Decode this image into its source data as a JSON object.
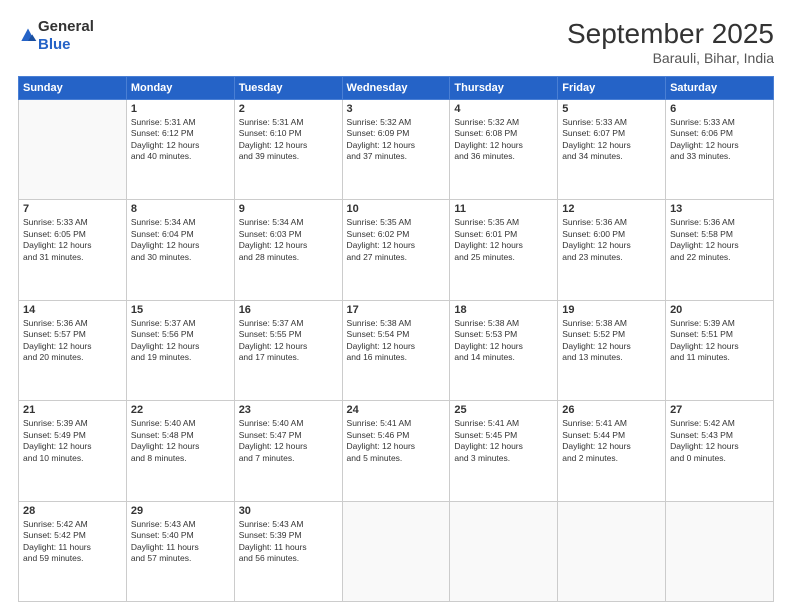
{
  "header": {
    "logo_general": "General",
    "logo_blue": "Blue",
    "month": "September 2025",
    "location": "Barauli, Bihar, India"
  },
  "weekdays": [
    "Sunday",
    "Monday",
    "Tuesday",
    "Wednesday",
    "Thursday",
    "Friday",
    "Saturday"
  ],
  "weeks": [
    [
      {
        "day": "",
        "info": ""
      },
      {
        "day": "1",
        "info": "Sunrise: 5:31 AM\nSunset: 6:12 PM\nDaylight: 12 hours\nand 40 minutes."
      },
      {
        "day": "2",
        "info": "Sunrise: 5:31 AM\nSunset: 6:10 PM\nDaylight: 12 hours\nand 39 minutes."
      },
      {
        "day": "3",
        "info": "Sunrise: 5:32 AM\nSunset: 6:09 PM\nDaylight: 12 hours\nand 37 minutes."
      },
      {
        "day": "4",
        "info": "Sunrise: 5:32 AM\nSunset: 6:08 PM\nDaylight: 12 hours\nand 36 minutes."
      },
      {
        "day": "5",
        "info": "Sunrise: 5:33 AM\nSunset: 6:07 PM\nDaylight: 12 hours\nand 34 minutes."
      },
      {
        "day": "6",
        "info": "Sunrise: 5:33 AM\nSunset: 6:06 PM\nDaylight: 12 hours\nand 33 minutes."
      }
    ],
    [
      {
        "day": "7",
        "info": "Sunrise: 5:33 AM\nSunset: 6:05 PM\nDaylight: 12 hours\nand 31 minutes."
      },
      {
        "day": "8",
        "info": "Sunrise: 5:34 AM\nSunset: 6:04 PM\nDaylight: 12 hours\nand 30 minutes."
      },
      {
        "day": "9",
        "info": "Sunrise: 5:34 AM\nSunset: 6:03 PM\nDaylight: 12 hours\nand 28 minutes."
      },
      {
        "day": "10",
        "info": "Sunrise: 5:35 AM\nSunset: 6:02 PM\nDaylight: 12 hours\nand 27 minutes."
      },
      {
        "day": "11",
        "info": "Sunrise: 5:35 AM\nSunset: 6:01 PM\nDaylight: 12 hours\nand 25 minutes."
      },
      {
        "day": "12",
        "info": "Sunrise: 5:36 AM\nSunset: 6:00 PM\nDaylight: 12 hours\nand 23 minutes."
      },
      {
        "day": "13",
        "info": "Sunrise: 5:36 AM\nSunset: 5:58 PM\nDaylight: 12 hours\nand 22 minutes."
      }
    ],
    [
      {
        "day": "14",
        "info": "Sunrise: 5:36 AM\nSunset: 5:57 PM\nDaylight: 12 hours\nand 20 minutes."
      },
      {
        "day": "15",
        "info": "Sunrise: 5:37 AM\nSunset: 5:56 PM\nDaylight: 12 hours\nand 19 minutes."
      },
      {
        "day": "16",
        "info": "Sunrise: 5:37 AM\nSunset: 5:55 PM\nDaylight: 12 hours\nand 17 minutes."
      },
      {
        "day": "17",
        "info": "Sunrise: 5:38 AM\nSunset: 5:54 PM\nDaylight: 12 hours\nand 16 minutes."
      },
      {
        "day": "18",
        "info": "Sunrise: 5:38 AM\nSunset: 5:53 PM\nDaylight: 12 hours\nand 14 minutes."
      },
      {
        "day": "19",
        "info": "Sunrise: 5:38 AM\nSunset: 5:52 PM\nDaylight: 12 hours\nand 13 minutes."
      },
      {
        "day": "20",
        "info": "Sunrise: 5:39 AM\nSunset: 5:51 PM\nDaylight: 12 hours\nand 11 minutes."
      }
    ],
    [
      {
        "day": "21",
        "info": "Sunrise: 5:39 AM\nSunset: 5:49 PM\nDaylight: 12 hours\nand 10 minutes."
      },
      {
        "day": "22",
        "info": "Sunrise: 5:40 AM\nSunset: 5:48 PM\nDaylight: 12 hours\nand 8 minutes."
      },
      {
        "day": "23",
        "info": "Sunrise: 5:40 AM\nSunset: 5:47 PM\nDaylight: 12 hours\nand 7 minutes."
      },
      {
        "day": "24",
        "info": "Sunrise: 5:41 AM\nSunset: 5:46 PM\nDaylight: 12 hours\nand 5 minutes."
      },
      {
        "day": "25",
        "info": "Sunrise: 5:41 AM\nSunset: 5:45 PM\nDaylight: 12 hours\nand 3 minutes."
      },
      {
        "day": "26",
        "info": "Sunrise: 5:41 AM\nSunset: 5:44 PM\nDaylight: 12 hours\nand 2 minutes."
      },
      {
        "day": "27",
        "info": "Sunrise: 5:42 AM\nSunset: 5:43 PM\nDaylight: 12 hours\nand 0 minutes."
      }
    ],
    [
      {
        "day": "28",
        "info": "Sunrise: 5:42 AM\nSunset: 5:42 PM\nDaylight: 11 hours\nand 59 minutes."
      },
      {
        "day": "29",
        "info": "Sunrise: 5:43 AM\nSunset: 5:40 PM\nDaylight: 11 hours\nand 57 minutes."
      },
      {
        "day": "30",
        "info": "Sunrise: 5:43 AM\nSunset: 5:39 PM\nDaylight: 11 hours\nand 56 minutes."
      },
      {
        "day": "",
        "info": ""
      },
      {
        "day": "",
        "info": ""
      },
      {
        "day": "",
        "info": ""
      },
      {
        "day": "",
        "info": ""
      }
    ]
  ]
}
